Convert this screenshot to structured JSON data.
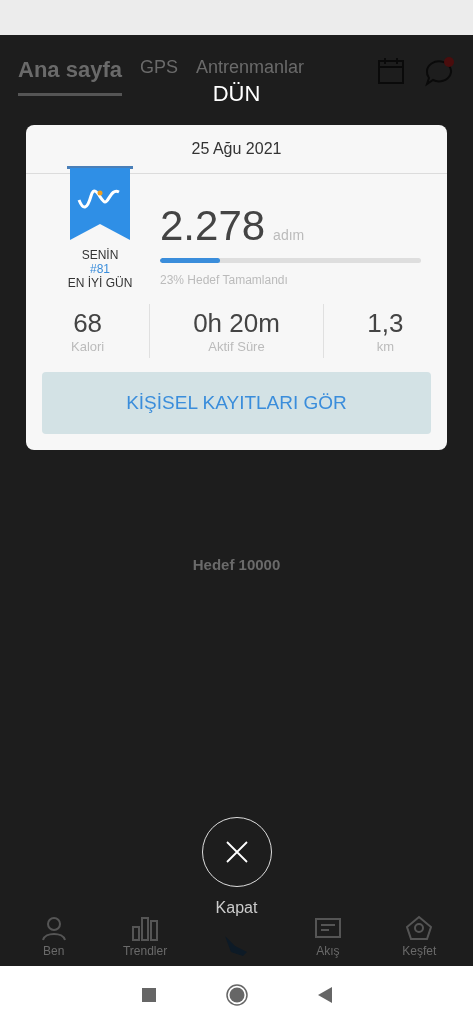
{
  "background": {
    "tabs": [
      {
        "label": "Ana sayfa",
        "selected": true
      },
      {
        "label": "GPS",
        "selected": false
      },
      {
        "label": "Antrenmanlar",
        "selected": false
      }
    ],
    "goal": "Hedef 10000",
    "nav": [
      {
        "kind": "person",
        "label": "Ben"
      },
      {
        "kind": "chart",
        "label": "Trendler"
      },
      {
        "kind": "shoe"
      },
      {
        "kind": "feed",
        "label": "Akış"
      },
      {
        "kind": "explore",
        "label": "Keşfet"
      }
    ]
  },
  "dialog": {
    "title": "DÜN",
    "date": "25 Ağu 2021",
    "badge": {
      "line1": "SENİN",
      "rank": "#81",
      "line2": "EN İYİ GÜN"
    },
    "steps": "2.278",
    "steps_unit": "adım",
    "progress": {
      "level": 0.23,
      "label": "23% Hedef Tamamlandı"
    },
    "stats": [
      {
        "value": "68",
        "label": "Kalori"
      },
      {
        "value": "0h 20m",
        "label": "Aktif Süre"
      },
      {
        "value": "1,3",
        "label": "km"
      }
    ],
    "button": "KİŞİSEL KAYITLARI GÖR",
    "close": "Kapat"
  }
}
